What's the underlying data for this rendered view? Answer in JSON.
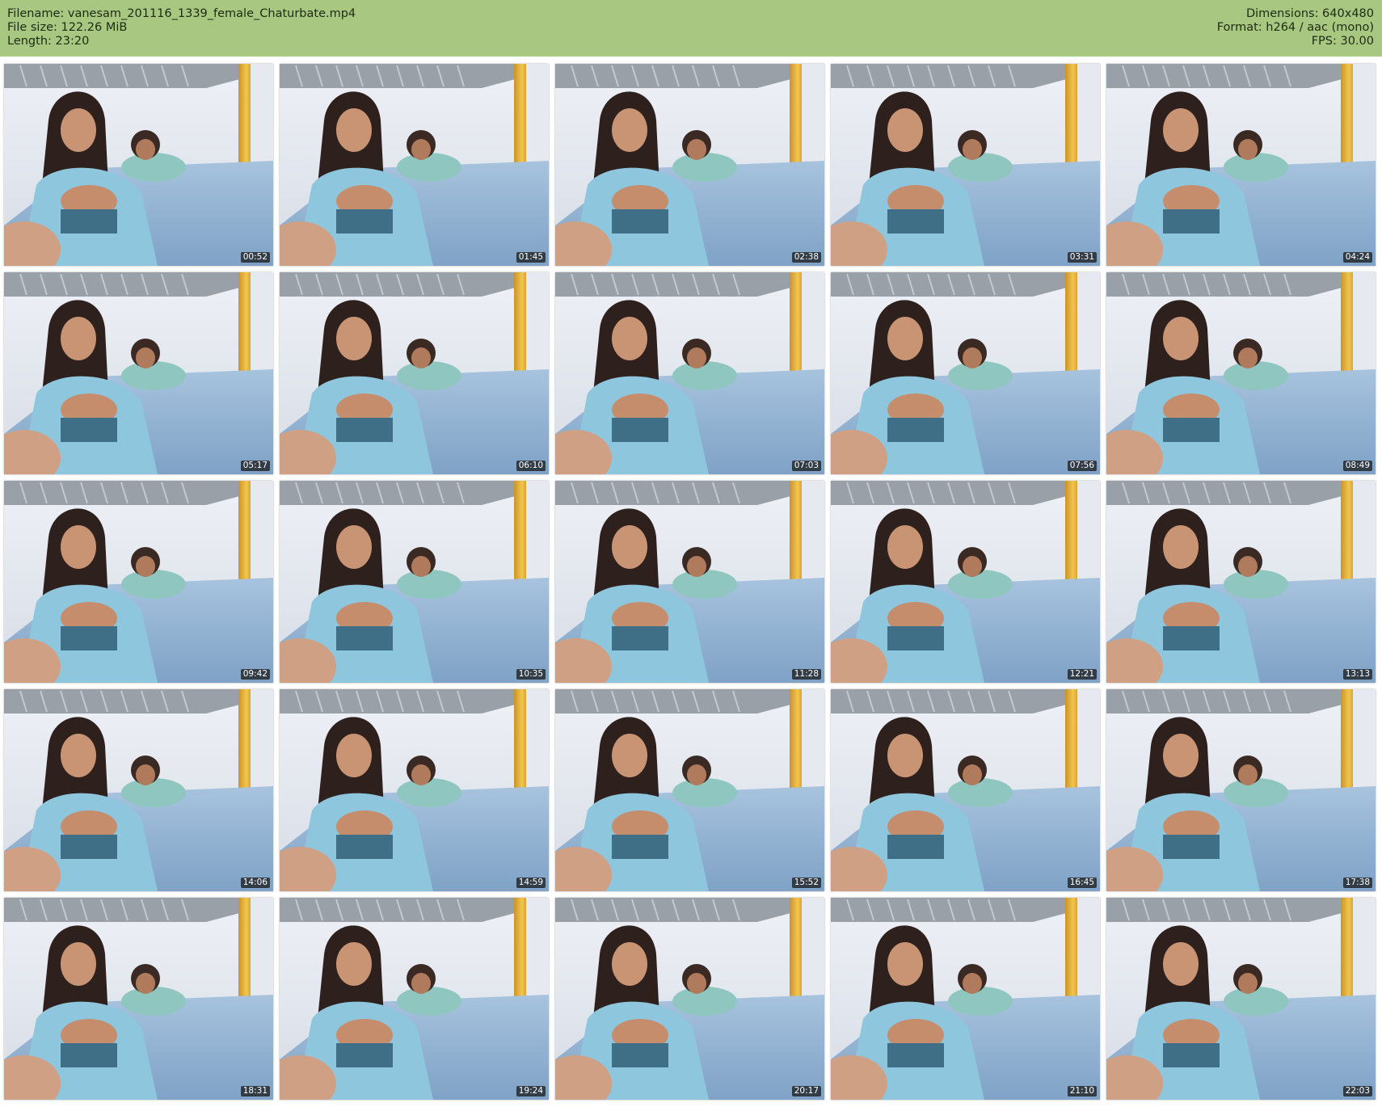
{
  "header": {
    "filename_line": "Filename: vanesam_201116_1339_female_Chaturbate.mp4",
    "filesize_line": "File size: 122.26 MiB",
    "length_line": "Length: 23:20",
    "dimensions_line": "Dimensions: 640x480",
    "format_line": "Format: h264 / aac (mono)",
    "fps_line": "FPS: 30.00",
    "background_color": "#a8c882"
  },
  "thumbnails": [
    {
      "timestamp": "00:52"
    },
    {
      "timestamp": "01:45"
    },
    {
      "timestamp": "02:38"
    },
    {
      "timestamp": "03:31"
    },
    {
      "timestamp": "04:24"
    },
    {
      "timestamp": "05:17"
    },
    {
      "timestamp": "06:10"
    },
    {
      "timestamp": "07:03"
    },
    {
      "timestamp": "07:56"
    },
    {
      "timestamp": "08:49"
    },
    {
      "timestamp": "09:42"
    },
    {
      "timestamp": "10:35"
    },
    {
      "timestamp": "11:28"
    },
    {
      "timestamp": "12:21"
    },
    {
      "timestamp": "13:13"
    },
    {
      "timestamp": "14:06"
    },
    {
      "timestamp": "14:59"
    },
    {
      "timestamp": "15:52"
    },
    {
      "timestamp": "16:45"
    },
    {
      "timestamp": "17:38"
    },
    {
      "timestamp": "18:31"
    },
    {
      "timestamp": "19:24"
    },
    {
      "timestamp": "20:17"
    },
    {
      "timestamp": "21:10"
    },
    {
      "timestamp": "22:03"
    }
  ]
}
